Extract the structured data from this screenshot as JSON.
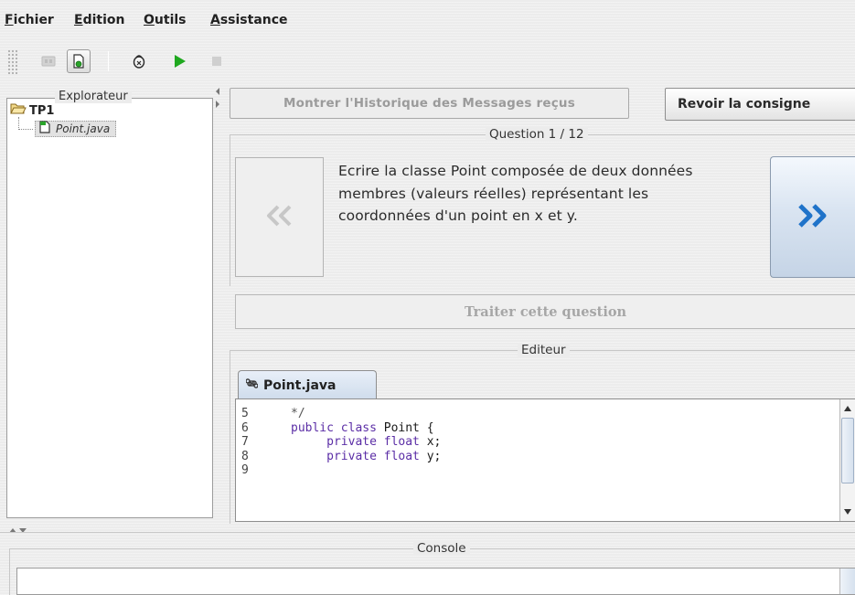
{
  "menu": {
    "items": [
      {
        "mnemonic": "F",
        "rest": "ichier"
      },
      {
        "mnemonic": "E",
        "rest": "dition"
      },
      {
        "mnemonic": "O",
        "rest": "utils"
      },
      {
        "mnemonic": "A",
        "rest": "ssistance"
      }
    ]
  },
  "toolbar": {
    "icons": [
      "stop-disabled-icon",
      "save-icon",
      "debug-icon",
      "run-icon",
      "stop-icon"
    ]
  },
  "explorer": {
    "title": "Explorateur",
    "root": "TP1",
    "files": [
      "Point.java"
    ]
  },
  "header": {
    "history_button": "Montrer l'Historique des Messages reçus",
    "consigne_button": "Revoir la consigne"
  },
  "question": {
    "legend": "Question 1 / 12",
    "text": "Ecrire la classe Point composée de deux données membres (valeurs réelles) représentant les coordonnées d'un point en x et y.",
    "prev_label": "«",
    "next_label": "»",
    "treat_button": "Traiter cette question"
  },
  "editor": {
    "legend": "Editeur",
    "tab_label": "Point.java",
    "line_numbers": [
      "5",
      "6",
      "7",
      "8",
      "9"
    ],
    "lines": [
      {
        "parts": [
          {
            "t": "*/",
            "c": "cm"
          }
        ]
      },
      {
        "parts": [
          {
            "t": "public class",
            "c": "kw"
          },
          {
            "t": " Point {",
            "c": ""
          }
        ]
      },
      {
        "parts": [
          {
            "t": "     private float",
            "c": "kw"
          },
          {
            "t": " x;",
            "c": ""
          }
        ]
      },
      {
        "parts": [
          {
            "t": "     private float",
            "c": "kw"
          },
          {
            "t": " y;",
            "c": ""
          }
        ]
      },
      {
        "parts": [
          {
            "t": "",
            "c": ""
          }
        ]
      }
    ]
  },
  "console": {
    "legend": "Console",
    "content": ""
  },
  "colors": {
    "keyword": "#5b2ea6",
    "next_button_arrow": "#1f73c9",
    "prev_button_arrow": "#c7c7c7",
    "run_green": "#1fa81f"
  }
}
